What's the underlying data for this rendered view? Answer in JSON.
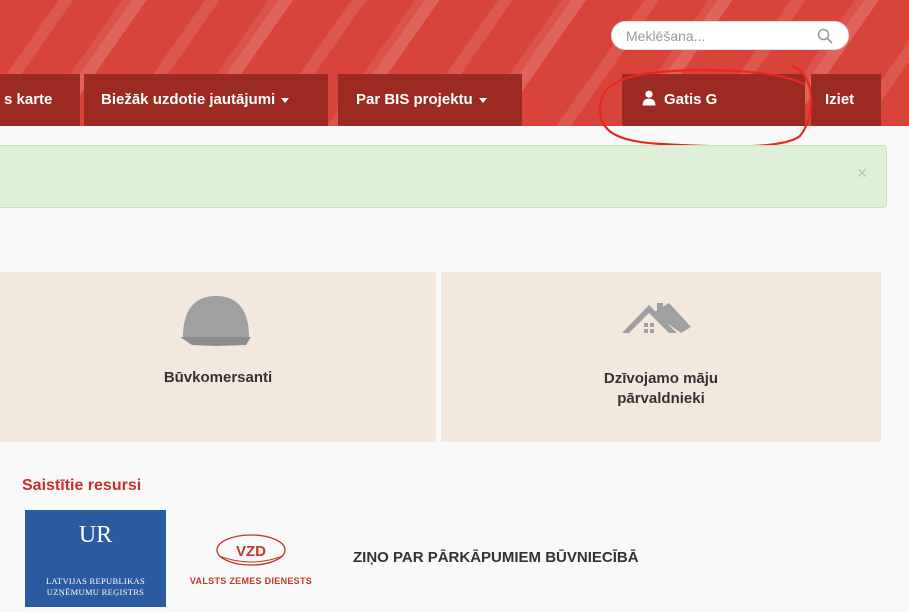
{
  "search": {
    "placeholder": "Meklēšana..."
  },
  "nav": {
    "items": [
      {
        "label": "s karte"
      },
      {
        "label": "Biežāk uzdotie jautājumi"
      },
      {
        "label": "Par BIS projektu"
      }
    ],
    "user": {
      "name": "Gatis G"
    },
    "logout": "Iziet"
  },
  "alert": {
    "close": "×"
  },
  "cards": [
    {
      "label": "Būvkomersanti",
      "icon": "hard-hat-icon"
    },
    {
      "label_line1": "Dzīvojamo māju",
      "label_line2": "pārvaldnieki",
      "icon": "house-icon"
    }
  ],
  "related": {
    "title": "Saistītie resursi",
    "ur": {
      "abbr": "UR",
      "line1": "LATVIJAS REPUBLIKAS",
      "line2": "UZŅĒMUMU REĢISTRS"
    },
    "vzd": {
      "abbr": "VZD",
      "name": "VALSTS ZEMES DIENESTS"
    },
    "report": "ZIŅO PAR PĀRKĀPUMIEM BŪVNIECĪBĀ"
  },
  "colors": {
    "header_red": "#d8443a",
    "nav_dark_red": "#9b2a22",
    "card_bg": "#f3e8de",
    "alert_green": "#dff0d8",
    "annotation_red": "#e8281e"
  }
}
